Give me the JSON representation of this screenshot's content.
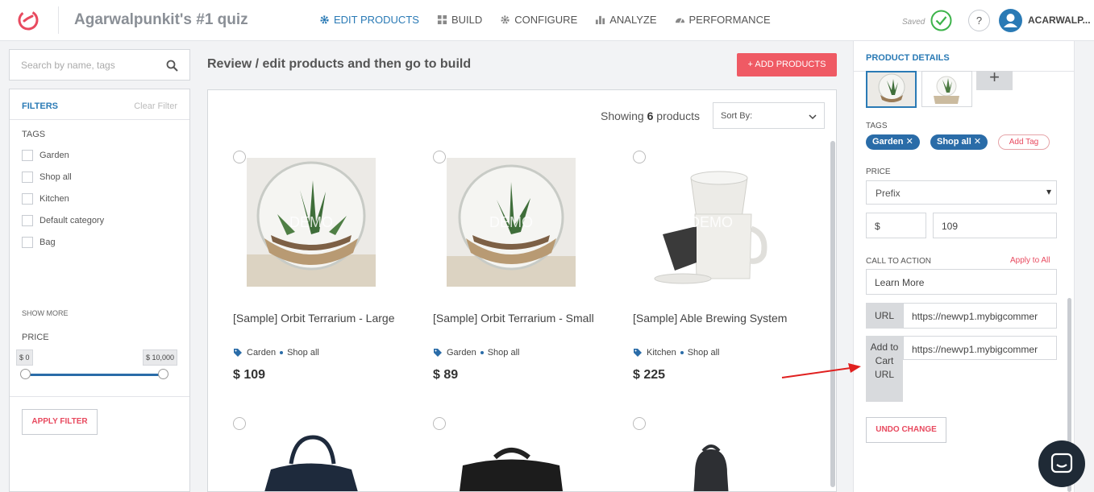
{
  "header": {
    "app_title": "Agarwalpunkit's #1 quiz",
    "nav": [
      {
        "label": "EDIT PRODUCTS",
        "icon": "gear-icon",
        "active": true
      },
      {
        "label": "BUILD",
        "icon": "grid-icon",
        "active": false
      },
      {
        "label": "CONFIGURE",
        "icon": "gear-icon",
        "active": false
      },
      {
        "label": "ANALYZE",
        "icon": "bar-chart-icon",
        "active": false
      },
      {
        "label": "PERFORMANCE",
        "icon": "speedometer-icon",
        "active": false
      }
    ],
    "saved_label": "Saved",
    "help_label": "?",
    "username": "ACARWALP..."
  },
  "sidebar": {
    "search_placeholder": "Search by name, tags",
    "filters_title": "FILTERS",
    "clear_filter": "Clear Filter",
    "tags_label": "TAGS",
    "tags": [
      "Garden",
      "Shop all",
      "Kitchen",
      "Default category",
      "Bag"
    ],
    "show_more": "SHOW MORE",
    "price_label": "PRICE",
    "price_min": "$ 0",
    "price_max": "$ 10,000",
    "apply_filter": "APPLY FILTER"
  },
  "main": {
    "heading": "Review / edit products and then go to build",
    "add_products": "+ ADD PRODUCTS",
    "showing_prefix": "Showing",
    "showing_count": "6",
    "showing_suffix": "products",
    "sort_label": "Sort By:",
    "watermark": "DEMO",
    "products": [
      {
        "title": "[Sample] Orbit Terrarium - Large",
        "tag1": "Carden",
        "tag2": "Shop all",
        "price": "$ 109"
      },
      {
        "title": "[Sample] Orbit Terrarium - Small",
        "tag1": "Garden",
        "tag2": "Shop all",
        "price": "$ 89"
      },
      {
        "title": "[Sample] Able Brewing System",
        "tag1": "Kitchen",
        "tag2": "Shop all",
        "price": "$ 225"
      }
    ]
  },
  "details": {
    "title": "PRODUCT DETAILS",
    "plus": "+",
    "tags_label": "TAGS",
    "tag_chips": [
      "Garden ✕",
      "Shop all ✕"
    ],
    "add_tag": "Add Tag",
    "price_label": "PRICE",
    "price_mode": "Prefix",
    "currency": "$",
    "price_value": "109",
    "cta_label": "CALL TO ACTION",
    "apply_all": "Apply to All",
    "cta_value": "Learn More",
    "url_label": "URL",
    "url_value": "https://newvp1.mybigcommer",
    "cart_label": "Add to Cart URL",
    "cart_value": "https://newvp1.mybigcommer",
    "undo": "UNDO CHANGE"
  },
  "colors": {
    "accent": "#2a7ab5",
    "brand_red": "#ef5a64",
    "tag_blue": "#2a6ca8",
    "check_green": "#3cb34a"
  }
}
